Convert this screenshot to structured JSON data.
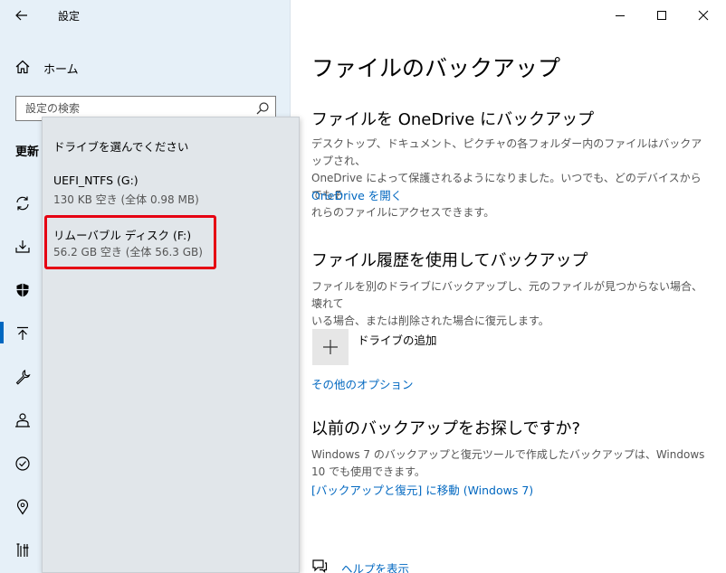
{
  "app": {
    "title": "設定",
    "back_icon": "back-arrow-icon"
  },
  "nav": {
    "home_label": "ホーム",
    "section_label": "更新",
    "icons": [
      "sync-icon",
      "delivery-icon",
      "shield-icon",
      "backup-arrow-icon",
      "wrench-icon",
      "person-recovery-icon",
      "check-circle-icon",
      "location-icon",
      "tools-icon"
    ]
  },
  "search": {
    "placeholder": "設定の検索"
  },
  "flyout": {
    "title": "ドライブを選んでください",
    "drives": [
      {
        "name": "UEFI_NTFS (G:)",
        "info": "130 KB 空き (全体 0.98 MB)"
      },
      {
        "name": "リムーバブル ディスク (F:)",
        "info": "56.2 GB 空き (全体 56.3 GB)"
      }
    ]
  },
  "content": {
    "page_title": "ファイルのバックアップ",
    "onedrive": {
      "heading": "ファイルを OneDrive にバックアップ",
      "line1": "デスクトップ、ドキュメント、ピクチャの各フォルダー内のファイルはバックアップされ、",
      "line2": "OneDrive によって保護されるようになりました。いつでも、どのデバイスからでもそ",
      "line3": "れらのファイルにアクセスできます。",
      "link": "OneDrive を開く"
    },
    "history": {
      "heading": "ファイル履歴を使用してバックアップ",
      "line1": "ファイルを別のドライブにバックアップし、元のファイルが見つからない場合、壊れて",
      "line2": "いる場合、または削除された場合に復元します。",
      "add_drive_label": "ドライブの追加",
      "more_options_link": "その他のオプション"
    },
    "older": {
      "heading": "以前のバックアップをお探しですか?",
      "line1": "Windows 7 のバックアップと復元ツールで作成したバックアップは、Windows",
      "line2": "10 でも使用できます。",
      "link": "[バックアップと復元] に移動 (Windows 7)"
    },
    "help_link": "ヘルプを表示"
  },
  "colors": {
    "accent": "#0067c0",
    "highlight": "#e60012",
    "sidebar_bg": "#e6f0f8"
  }
}
